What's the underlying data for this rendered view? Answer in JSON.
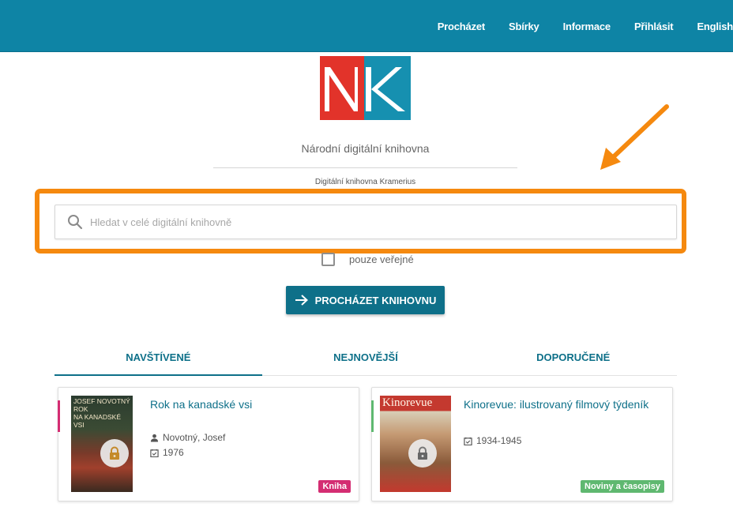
{
  "header": {
    "nav": [
      "Procházet",
      "Sbírky",
      "Informace",
      "Přihlásit",
      "English"
    ]
  },
  "logo": {
    "alt": "NK"
  },
  "site": {
    "title": "Národní digitální knihovna",
    "subtitle": "Digitální knihovna Kramerius"
  },
  "search": {
    "placeholder": "Hledat v celé digitální knihovně",
    "value": ""
  },
  "public_only": {
    "label": "pouze veřejné",
    "checked": false
  },
  "browse_button": {
    "label": "PROCHÁZET KNIHOVNU"
  },
  "tabs": [
    {
      "label": "NAVŠTÍVENÉ",
      "active": true
    },
    {
      "label": "NEJNOVĚJŠÍ",
      "active": false
    },
    {
      "label": "DOPORUČENÉ",
      "active": false
    }
  ],
  "cards": [
    {
      "title": "Rok na kanadské vsi",
      "author": "Novotný, Josef",
      "year": "1976",
      "badge": "Kniha",
      "cover_text": "JOSEF NOVOTNÝ\nROK\nNA KANADSKÉ\nVSI",
      "locked": true,
      "accent_color": "#d42d72"
    },
    {
      "title": "Kinorevue: ilustrovaný filmový týdeník",
      "year": "1934-1945",
      "badge": "Noviny a časopisy",
      "cover_text": "Kinorevue",
      "locked": true,
      "accent_color": "#5fb870"
    }
  ],
  "colors": {
    "header": "#0e84a5",
    "primary": "#0e7089",
    "highlight": "#f5890f",
    "logo_red": "#e2332a",
    "logo_blue": "#1690b0"
  }
}
